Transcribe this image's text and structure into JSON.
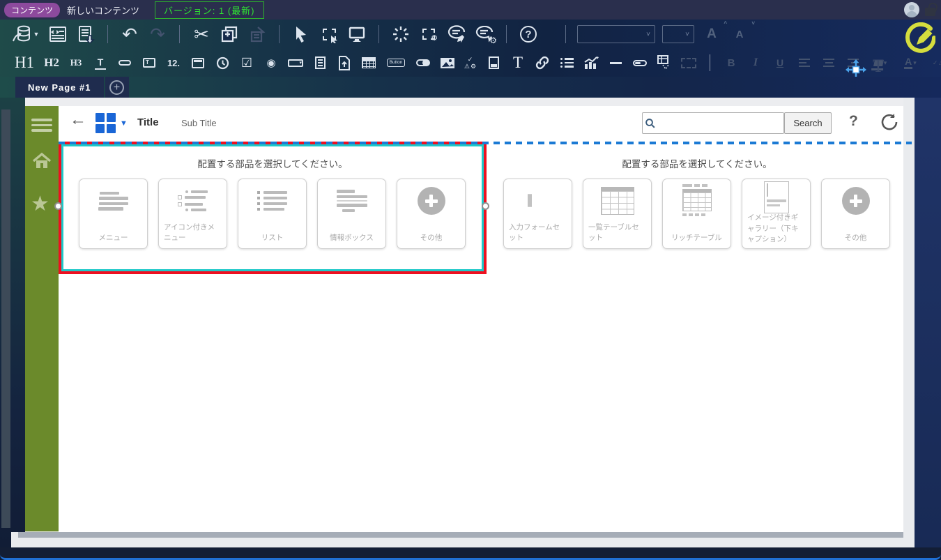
{
  "topbar": {
    "badge": "コンテンツ",
    "title": "新しいコンテンツ",
    "version": "バージョン: 1 (最新)"
  },
  "toolbar": {
    "row1_icons": [
      "save-stack",
      "save-dropdown",
      "code-view",
      "export-document",
      "undo",
      "redo",
      "cut",
      "copy",
      "paste",
      "pointer",
      "region-select",
      "preview-monitor",
      "burst",
      "region-settings",
      "comment-edit",
      "comment-settings",
      "help",
      "font-family-select",
      "font-size-select",
      "font-increase",
      "font-decrease",
      "move",
      "text-tool",
      "edit-mode-pencil"
    ],
    "row2_icons": [
      "heading1",
      "heading2",
      "heading3",
      "text-field",
      "link-field",
      "textarea",
      "number-field",
      "date-field",
      "time-field",
      "checkbox",
      "radio-button",
      "dropdown",
      "list-box",
      "file-upload",
      "table",
      "button",
      "toggle",
      "image",
      "status-icons",
      "image-card",
      "text",
      "hyperlink",
      "bullet-list",
      "chart",
      "horizontal-rule",
      "pill",
      "table-action",
      "placeholder-box",
      "bold",
      "italic",
      "underline",
      "align-left",
      "align-center",
      "align-right",
      "highlight-color",
      "font-color",
      "status-color"
    ],
    "h1": "H1",
    "h2": "H2",
    "h3": "H3",
    "field_t": "T",
    "num": "12.",
    "button_label": "Button",
    "big_t": "T",
    "bold": "B",
    "italic": "I",
    "underline": "U",
    "font_color": "A",
    "font_inc": "A",
    "font_dec": "A",
    "help": "?",
    "text_tool": "T"
  },
  "tabbar": {
    "tabs": [
      {
        "label": "New Page #1"
      }
    ],
    "add": "+"
  },
  "canvas": {
    "title": "Title",
    "subtitle": "Sub Title",
    "search": {
      "placeholder": "",
      "button_label": "Search"
    },
    "help": "?",
    "sidebar_icons": [
      "menu",
      "home",
      "favorite"
    ],
    "left_panel": {
      "header": "配置する部品を選択してください。",
      "tiles": [
        {
          "label": "メニュー",
          "icon": "menu-lines"
        },
        {
          "label": "アイコン付きメニュー",
          "icon": "icon-menu"
        },
        {
          "label": "リスト",
          "icon": "bullet-list"
        },
        {
          "label": "情報ボックス",
          "icon": "info-box"
        },
        {
          "label": "その他",
          "icon": "plus-circle"
        }
      ]
    },
    "right_panel": {
      "header": "配置する部品を選択してください。",
      "tiles": [
        {
          "label": "入力フォームセット",
          "icon": "form-set"
        },
        {
          "label": "一覧テーブルセット",
          "icon": "table-set"
        },
        {
          "label": "リッチテーブル",
          "icon": "rich-table"
        },
        {
          "label": "イメージ付きギャラリー（下キャプション）",
          "icon": "image-gallery"
        },
        {
          "label": "その他",
          "icon": "plus-circle"
        }
      ]
    }
  },
  "colors": {
    "selection_red": "#ee1020",
    "selection_cyan": "#1ec9c9",
    "guide_blue": "#1b7ad4",
    "sidebar_green": "#6b8a2b",
    "badge_purple": "#8d4a9d",
    "version_green": "#2fe133",
    "accent_yellow": "#d5dd3e",
    "move_blue": "#49a2ea",
    "grid_blue": "#1a66d6"
  }
}
